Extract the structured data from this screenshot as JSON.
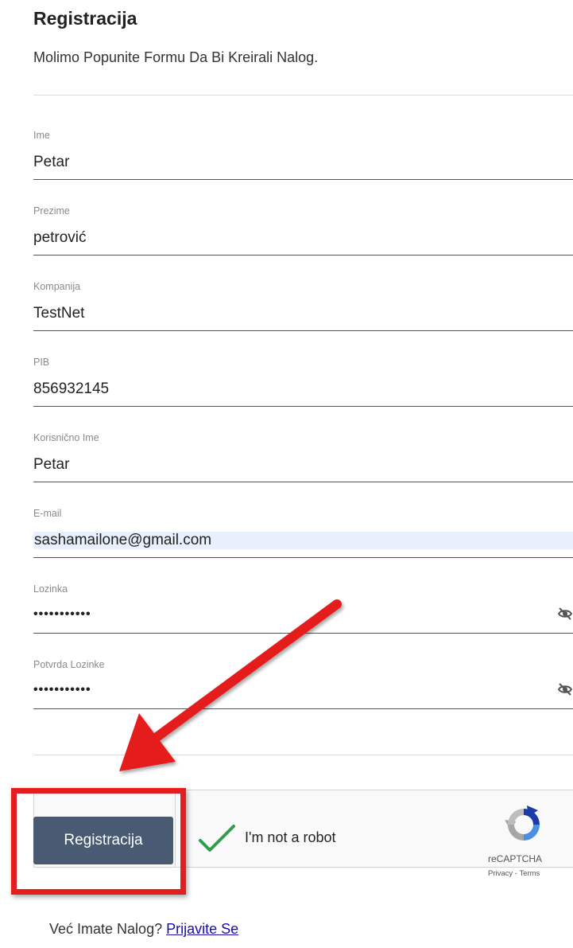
{
  "header": {
    "title": "Registracija",
    "subtitle": "Molimo Popunite Formu Da Bi Kreirali Nalog."
  },
  "form": {
    "fields": [
      {
        "label": "Ime",
        "value": "Petar"
      },
      {
        "label": "Prezime",
        "value": "petrović"
      },
      {
        "label": "Kompanija",
        "value": "TestNet"
      },
      {
        "label": "PIB",
        "value": "856932145"
      },
      {
        "label": "Korisničnо Ime",
        "value": "Petar"
      },
      {
        "label": "E-mail",
        "value": "sashamailone@gmail.com"
      },
      {
        "label": "Lozinka",
        "value": "•••••••••••"
      },
      {
        "label": "Potvrda Lozinke",
        "value": "•••••••••••"
      }
    ],
    "submit_label": "Registracija"
  },
  "captcha": {
    "text": "I'm not a robot",
    "brand": "reCAPTCHA",
    "privacy": "Privacy",
    "separator": " - ",
    "terms": "Terms",
    "checked": true
  },
  "footer": {
    "question": "Već Imate Nalog?",
    "link": "Prijavite Se"
  },
  "colors": {
    "button": "#485b73",
    "highlight": "#e41e1e",
    "check": "#2e9e4f",
    "autofill": "#e8f0fe"
  }
}
